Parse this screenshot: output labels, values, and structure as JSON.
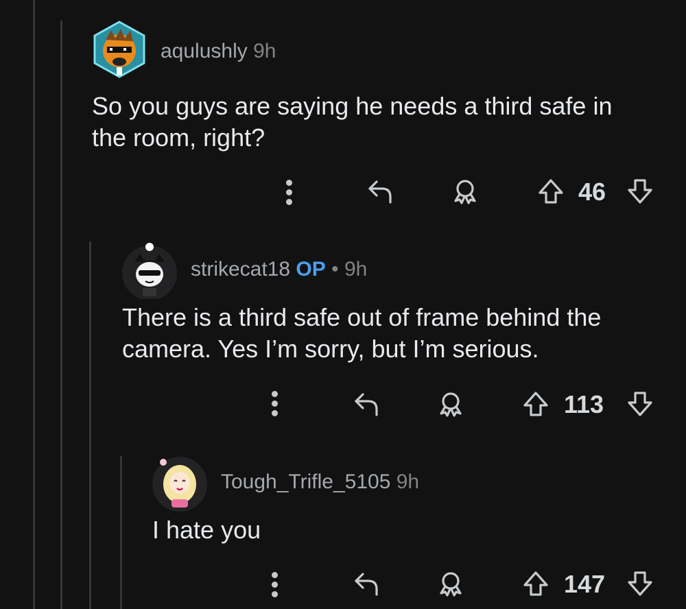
{
  "comments": [
    {
      "username": "aqulushly",
      "time": "9h",
      "text_lines": [
        "So you guys are saying he needs a third safe in",
        "the room, right?"
      ],
      "score": "46"
    },
    {
      "username": "strikecat18",
      "op_badge": "OP",
      "separator": "•",
      "time": "9h",
      "text_lines": [
        "There is a third safe out of frame behind the",
        "camera. Yes I’m sorry, but I’m serious."
      ],
      "score": "113"
    },
    {
      "username": "Tough_Trifle_5105",
      "time": "9h",
      "text_lines": [
        "I hate you"
      ],
      "score": "147"
    }
  ],
  "icons": {
    "more": "more-options-icon",
    "reply": "reply-icon",
    "award": "award-icon",
    "upvote": "upvote-arrow-icon",
    "downvote": "downvote-arrow-icon"
  },
  "colors": {
    "background": "#121213",
    "op_badge": "#4a9eed",
    "thread_line": "#343536"
  }
}
